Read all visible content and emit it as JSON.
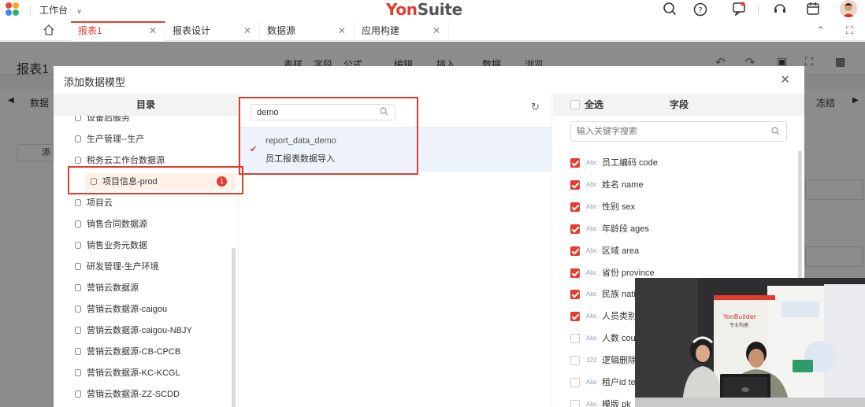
{
  "topbar": {
    "workbench": "工作台",
    "brand_a": "Yon",
    "brand_b": "Suite"
  },
  "tabs": [
    {
      "label": "报表1",
      "active": true
    },
    {
      "label": "报表设计",
      "active": false
    },
    {
      "label": "数据源",
      "active": false
    },
    {
      "label": "应用构建",
      "active": false
    }
  ],
  "background": {
    "page_title": "报表1",
    "toolbar": [
      "表样",
      "字段",
      "公式",
      "编辑",
      "插入",
      "数据",
      "浏览"
    ],
    "side_label": "数据",
    "add_label": "添",
    "freeze_label": "冻结"
  },
  "modal": {
    "title": "添加数据模型",
    "catalog_header": "目录",
    "catalog": [
      {
        "label": "设备后服务"
      },
      {
        "label": "生产管理--生产"
      },
      {
        "label": "税务云工作台数据源"
      },
      {
        "label": "项目信息-prod",
        "selected": true,
        "badge": "1"
      },
      {
        "label": "项目云"
      },
      {
        "label": "销售合同数据源"
      },
      {
        "label": "销售业务元数据"
      },
      {
        "label": "研发管理-生产环境"
      },
      {
        "label": "营销云数据源"
      },
      {
        "label": "营销云数据源-caigou"
      },
      {
        "label": "营销云数据源-caigou-NBJY"
      },
      {
        "label": "营销云数据源-CB-CPCB"
      },
      {
        "label": "营销云数据源-KC-KCGL"
      },
      {
        "label": "营销云数据源-ZZ-SCDD"
      }
    ],
    "search_value": "demo",
    "result": {
      "name": "report_data_demo",
      "desc": "员工报表数据导入"
    },
    "select_all": "全选",
    "fields_header": "字段",
    "field_search_placeholder": "输入关键字搜索",
    "fields": [
      {
        "type": "Abc",
        "label": "员工编码 code",
        "checked": true
      },
      {
        "type": "Abc",
        "label": "姓名 name",
        "checked": true
      },
      {
        "type": "Abc",
        "label": "性别 sex",
        "checked": true
      },
      {
        "type": "Abc",
        "label": "年龄段 ages",
        "checked": true
      },
      {
        "type": "Abc",
        "label": "区域 area",
        "checked": true
      },
      {
        "type": "Abc",
        "label": "省份 province",
        "checked": true
      },
      {
        "type": "Abc",
        "label": "民族 nati",
        "checked": true
      },
      {
        "type": "Abc",
        "label": "人员类别",
        "checked": true
      },
      {
        "type": "Abc",
        "label": "人数 cou",
        "checked": false
      },
      {
        "type": "123",
        "label": "逻辑删除",
        "checked": false
      },
      {
        "type": "Abc",
        "label": "租户id te",
        "checked": false
      },
      {
        "type": "Abc",
        "label": "模版 pk_t",
        "checked": false
      }
    ]
  },
  "video": {
    "banner_brand": "YonBuilder",
    "banner_sub": "专业构建"
  },
  "colors": {
    "accent": "#e23c2f"
  }
}
